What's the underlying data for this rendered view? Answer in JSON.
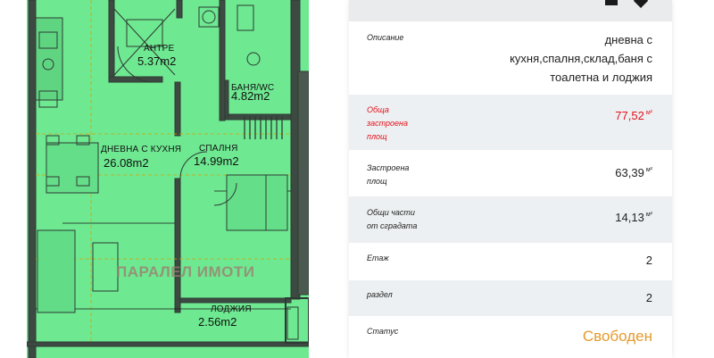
{
  "plan": {
    "rooms": [
      {
        "name": "АНТРЕ",
        "area": "5.37m2"
      },
      {
        "name": "БАНЯ/WC",
        "area": "4.82m2"
      },
      {
        "name": "ДНЕВНА С КУХНЯ",
        "area": "26.08m2"
      },
      {
        "name": "СПАЛНЯ",
        "area": "14.99m2"
      },
      {
        "name": "ЛОДЖИЯ",
        "area": "2.56m2"
      }
    ],
    "watermark": "ПАРАЛЕЛ ИМОТИ"
  },
  "details": {
    "icons": [
      "print-icon",
      "heart-icon"
    ],
    "rows": [
      {
        "label": "Описание",
        "value": [
          "дневна с",
          "кухня,спалня,склад,баня с",
          "тоалетна и лоджия"
        ]
      },
      {
        "label": "Обща застроена площ",
        "label_lines": [
          "Обща",
          "застроена",
          "площ"
        ],
        "value": "77,52",
        "unit": "м²",
        "accent": "#e3121b"
      },
      {
        "label_lines": [
          "Застроена",
          "площ"
        ],
        "value": "63,39",
        "unit": "м²"
      },
      {
        "label_lines": [
          "Общи части",
          "от сградата"
        ],
        "value": "14,13",
        "unit": "м²"
      },
      {
        "label_lines": [
          "Етаж"
        ],
        "value": "2"
      },
      {
        "label_lines": [
          "раздел"
        ],
        "value": "2"
      },
      {
        "label_lines": [
          "Статус"
        ],
        "value": "Свободен",
        "accent": "#e59b2d"
      }
    ]
  }
}
